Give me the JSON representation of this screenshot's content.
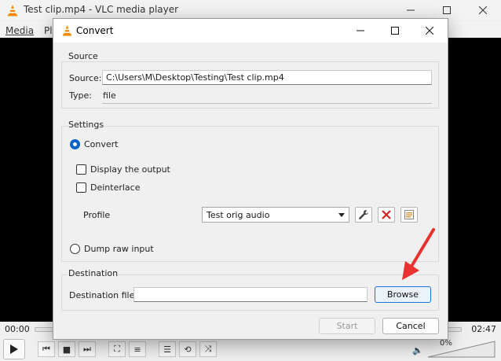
{
  "vlc": {
    "window_title": "Test clip.mp4 - VLC media player",
    "menu": [
      "Media",
      "Pl"
    ],
    "time_elapsed": "00:00",
    "time_total": "02:47",
    "volume": "0%"
  },
  "dialog": {
    "title": "Convert",
    "source": {
      "group_label": "Source",
      "source_label": "Source:",
      "source_value": "C:\\Users\\M\\Desktop\\Testing\\Test clip.mp4",
      "type_label": "Type:",
      "type_value": "file"
    },
    "settings": {
      "group_label": "Settings",
      "convert_label": "Convert",
      "convert_checked": true,
      "display_output_label": "Display the output",
      "deinterlace_label": "Deinterlace",
      "profile_label": "Profile",
      "profile_value": "Test orig audio",
      "dump_raw_label": "Dump raw input"
    },
    "destination": {
      "group_label": "Destination",
      "file_label": "Destination file:",
      "file_value": "",
      "browse_label": "Browse"
    },
    "start_label": "Start",
    "cancel_label": "Cancel"
  },
  "colors": {
    "accent": "#0a64c8",
    "annotation_arrow": "#e8322f",
    "vlc_orange": "#f08a00"
  }
}
